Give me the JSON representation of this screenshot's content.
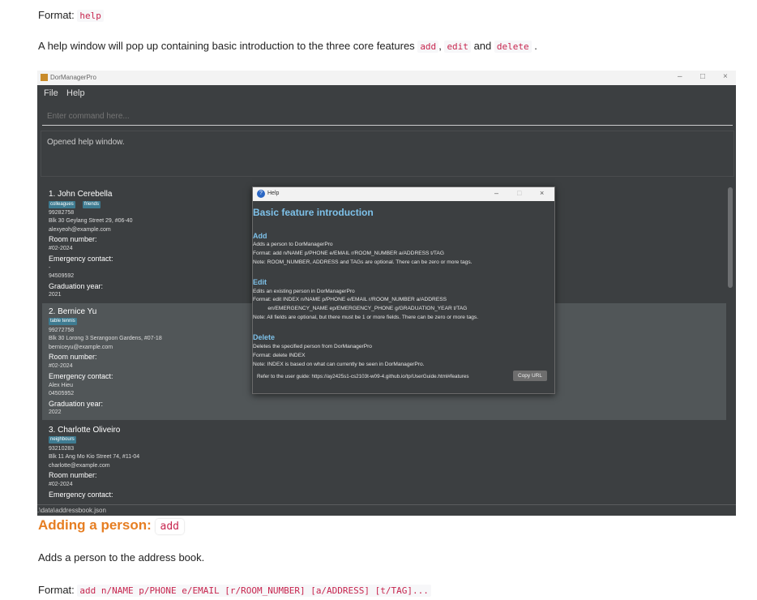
{
  "doc": {
    "format_label": "Format:",
    "format_help_code": "help",
    "intro_text": "A help window will pop up containing basic introduction to the three core features",
    "code_add": "add",
    "code_edit": "edit",
    "code_delete": "delete",
    "sep_comma": ",",
    "sep_and": "and",
    "sep_period": ".",
    "heading": "Adding a person:",
    "heading_code": "add",
    "add_desc": "Adds a person to the address book.",
    "format2_label": "Format:",
    "format2_code": "add n/NAME p/PHONE e/EMAIL [r/ROOM_NUMBER] [a/ADDRESS] [t/TAG]..."
  },
  "app": {
    "window_title": "DorManagerPro",
    "window_controls": [
      "–",
      "□",
      "×"
    ],
    "menu": [
      "File",
      "Help"
    ],
    "command_placeholder": "Enter command here...",
    "result_text": "Opened help window.",
    "status_path": ".\\data\\addressbook.json",
    "persons": [
      {
        "name": "1. John Cerebella",
        "tags": [
          "colleagues",
          "friends"
        ],
        "phone": "99282758",
        "address": "Blk 30 Geylang Street 29, #06-40",
        "email": "alexyeoh@example.com",
        "room_label": "Room number:",
        "room": "#02-2024",
        "emergency_label": "Emergency contact:",
        "emergency_name": "-",
        "emergency_phone": "94509592",
        "grad_label": "Graduation year:",
        "grad": "2021"
      },
      {
        "name": "2. Bernice Yu",
        "tags": [
          "table tennis"
        ],
        "phone": "99272758",
        "address": "Blk 30 Lorong 3 Serangoon Gardens, #07-18",
        "email": "berniceyu@example.com",
        "room_label": "Room number:",
        "room": "#02-2024",
        "emergency_label": "Emergency contact:",
        "emergency_name": "Alex Hieu",
        "emergency_phone": "04505952",
        "grad_label": "Graduation year:",
        "grad": "2022"
      },
      {
        "name": "3. Charlotte Oliveiro",
        "tags": [
          "neighbours"
        ],
        "phone": "93210283",
        "address": "Blk 11 Ang Mo Kio Street 74, #11-04",
        "email": "charlotte@example.com",
        "room_label": "Room number:",
        "room": "#02-2024",
        "emergency_label": "Emergency contact:"
      }
    ]
  },
  "help": {
    "title": "Help",
    "heading": "Basic feature introduction",
    "add_title": "Add",
    "add_lines": [
      "Adds a person to DorManagerPro",
      "Format: add n/NAME p/PHONE e/EMAIL r/ROOM_NUMBER a/ADDRESS t/TAG",
      "Note: ROOM_NUMBER, ADDRESS and TAGs are optional. There can be zero or more tags."
    ],
    "edit_title": "Edit",
    "edit_lines": [
      "Edits an existing person in DorManagerPro",
      "Format: edit INDEX n/NAME p/PHONE e/EMAIL r/ROOM_NUMBER a/ADDRESS",
      "          en/EMERGENCY_NAME ep/EMERGENCY_PHONE g/GRADUATION_YEAR t/TAG",
      "Note: All fields are optional, but there must be 1 or more fields. There can be zero or more tags."
    ],
    "delete_title": "Delete",
    "delete_lines": [
      "Deletes the specified person from DorManagerPro",
      "Format: delete INDEX",
      "Note: INDEX is based on what can currently be seen in DorManagerPro."
    ],
    "url_text": "Refer to the user guide: https://ay2425s1-cs2103t-w09-4.github.io/tp/UserGuide.html#features",
    "copy_button": "Copy URL"
  }
}
